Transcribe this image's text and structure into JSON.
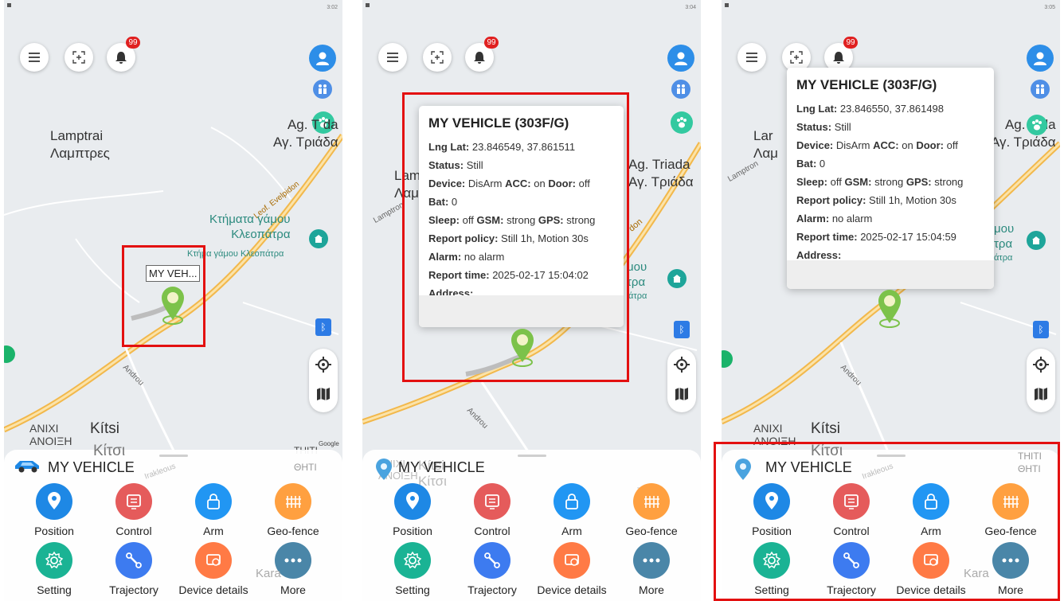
{
  "times": [
    "3:02",
    "3:04",
    "3:05"
  ],
  "notification_count": "99",
  "map": {
    "lamptrai_latin": "Lamptrai",
    "lamptrai_greek": "Λαμπτρες",
    "agtriada_latin_short": "Ag. T",
    "agtriada_latin_1": "da",
    "agtriada_greek": "Αγ. Τριάδα",
    "agtriada_latin": "Ag. Triada",
    "venue_greek": "Κτήματα γάμου",
    "venue_greek_2": "Κλεοπάτρα",
    "venue_small": "Κτήμα γάμου Κλεοπάτρα",
    "road_evelpidon": "Leof. Evelpidon",
    "road_androu": "Androu",
    "lamptron": "Lamptron",
    "anixi": "ANIXI",
    "anoixi": "ΑΝΟΙΞΗ",
    "kitsi": "Kítsi",
    "kitsi_greek": "Κίτσι",
    "thiti": "THITI",
    "thiti_greek": "ΘΗΤΙ",
    "irakleous": "Irakleous",
    "kara": "Kara",
    "google": "Google",
    "partial_lam": "Lam",
    "partial_lap": "Λαμ",
    "partial_lan": "Lar",
    "partial_lap2": "Λαμ",
    "partial_don": "don",
    "partial_mou": "μου",
    "partial_tra": "τρα",
    "partial_atra": "άτρα"
  },
  "marker_callout": "MY VEH...",
  "popups": [
    {
      "title": "MY VEHICLE (303F/G)",
      "lnglat_label": "Lng Lat:",
      "lnglat": "23.846549, 37.861511",
      "status_label": "Status:",
      "status": "Still",
      "device_label": "Device:",
      "device": "DisArm",
      "acc_label": "ACC:",
      "acc": "on",
      "door_label": "Door:",
      "door": "off",
      "bat_label": "Bat:",
      "bat": "0",
      "sleep_label": "Sleep:",
      "sleep": "off",
      "gsm_label": "GSM:",
      "gsm": "strong",
      "gps_label": "GPS:",
      "gps": "strong",
      "policy_label": "Report policy:",
      "policy": "Still 1h, Motion 30s",
      "alarm_label": "Alarm:",
      "alarm": "no alarm",
      "time_label": "Report time:",
      "time": "2025-02-17 15:04:02",
      "address_label": "Address:"
    },
    {
      "title": "MY VEHICLE (303F/G)",
      "lnglat_label": "Lng Lat:",
      "lnglat": "23.846550, 37.861498",
      "status_label": "Status:",
      "status": "Still",
      "device_label": "Device:",
      "device": "DisArm",
      "acc_label": "ACC:",
      "acc": "on",
      "door_label": "Door:",
      "door": "off",
      "bat_label": "Bat:",
      "bat": "0",
      "sleep_label": "Sleep:",
      "sleep": "off",
      "gsm_label": "GSM:",
      "gsm": "strong",
      "gps_label": "GPS:",
      "gps": "strong",
      "policy_label": "Report policy:",
      "policy": "Still 1h, Motion 30s",
      "alarm_label": "Alarm:",
      "alarm": "no alarm",
      "time_label": "Report time:",
      "time": "2025-02-17 15:04:59",
      "address_label": "Address:"
    }
  ],
  "sheet": {
    "vehicle_name": "MY VEHICLE",
    "actions": [
      {
        "label": "Position",
        "icon": "location-pin-icon",
        "color": "#1e88e5"
      },
      {
        "label": "Control",
        "icon": "control-panel-icon",
        "color": "#e55b5b"
      },
      {
        "label": "Arm",
        "icon": "lock-icon",
        "color": "#2196f3"
      },
      {
        "label": "Geo-fence",
        "icon": "fence-icon",
        "color": "#ffa040"
      },
      {
        "label": "Setting",
        "icon": "gear-icon",
        "color": "#1ab394"
      },
      {
        "label": "Trajectory",
        "icon": "route-icon",
        "color": "#3d7bf0"
      },
      {
        "label": "Device details",
        "icon": "device-details-icon",
        "color": "#ff7a45"
      },
      {
        "label": "More",
        "icon": "more-dots-icon",
        "color": "#4a86a8"
      }
    ]
  },
  "colors": {
    "highlight": "#e31010",
    "marker": "#7cc24a",
    "road": "#f2b84b"
  }
}
